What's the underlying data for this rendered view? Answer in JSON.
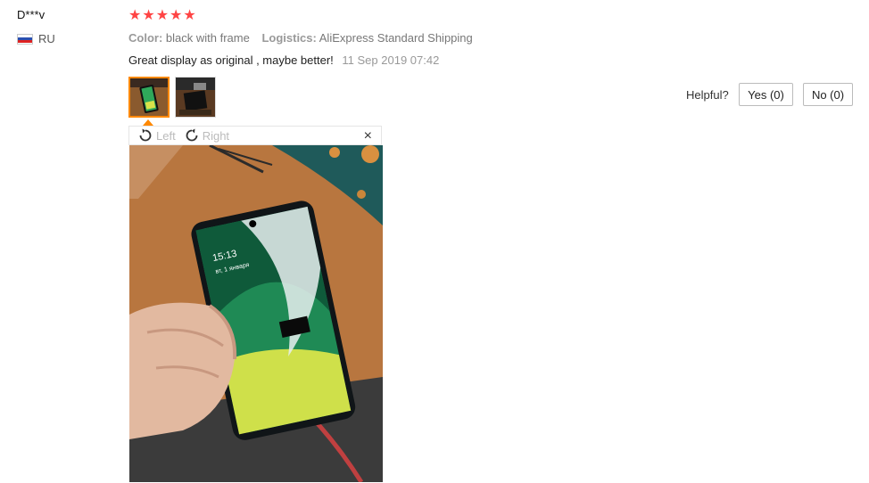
{
  "review": {
    "user": "D***v",
    "country": "RU",
    "rating_stars": 5,
    "color_label": "Color:",
    "color_value": "black with frame",
    "logistics_label": "Logistics:",
    "logistics_value": "AliExpress Standard Shipping",
    "text": "Great display as original , maybe better!",
    "date": "11 Sep 2019 07:42"
  },
  "viewer": {
    "rotate_left": "Left",
    "rotate_right": "Right",
    "close": "×"
  },
  "helpful": {
    "label": "Helpful?",
    "yes": "Yes (0)",
    "no": "No (0)"
  },
  "phone_screen": {
    "time": "15:13",
    "date": "вт, 1 января"
  },
  "colors": {
    "star": "#ff4444",
    "active_thumb": "#ff8800"
  }
}
